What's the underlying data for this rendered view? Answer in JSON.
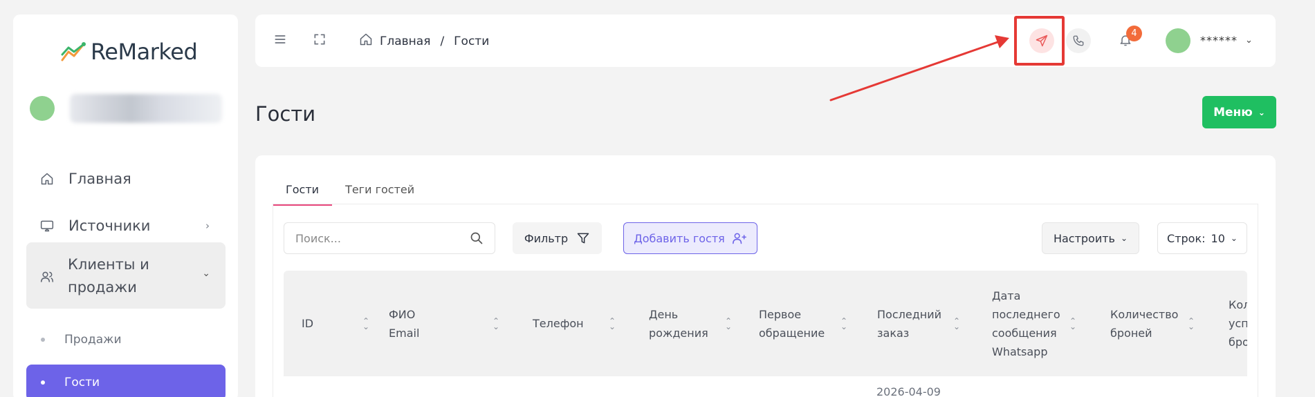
{
  "brand": {
    "name": "ReMarked"
  },
  "sidebar": {
    "items": [
      {
        "label": "Главная",
        "icon": "home-icon"
      },
      {
        "label": "Источники",
        "icon": "monitor-icon"
      },
      {
        "label": "Клиенты и продажи",
        "icon": "users-icon"
      }
    ],
    "subitems": [
      {
        "label": "Продажи",
        "active": false
      },
      {
        "label": "Гости",
        "active": true
      }
    ]
  },
  "header": {
    "breadcrumb": [
      "Главная",
      "Гости"
    ],
    "notifications_count": "4",
    "user_name": "******",
    "icons": [
      "menu-icon",
      "fullscreen-icon",
      "telegram-icon",
      "phone-icon",
      "bell-icon",
      "chevron-down-icon"
    ]
  },
  "page": {
    "title": "Гости",
    "menu_label": "Меню"
  },
  "tabs": [
    "Гости",
    "Теги гостей"
  ],
  "toolbar": {
    "search_placeholder": "Поиск...",
    "filter_label": "Фильтр",
    "add_label": "Добавить гостя",
    "config_label": "Настроить",
    "rows_label": "Строк:",
    "rows_value": "10"
  },
  "table": {
    "columns": [
      {
        "line1": "ID",
        "line2": "",
        "line3": "",
        "line4": ""
      },
      {
        "line1": "ФИО",
        "line2": "Email",
        "line3": "",
        "line4": ""
      },
      {
        "line1": "Телефон",
        "line2": "",
        "line3": "",
        "line4": ""
      },
      {
        "line1": "День",
        "line2": "рождения",
        "line3": "",
        "line4": ""
      },
      {
        "line1": "Первое",
        "line2": "обращение",
        "line3": "",
        "line4": ""
      },
      {
        "line1": "Последний",
        "line2": "заказ",
        "line3": "",
        "line4": ""
      },
      {
        "line1": "Дата",
        "line2": "последнего",
        "line3": "сообщения",
        "line4": "Whatsapp"
      },
      {
        "line1": "Количество",
        "line2": "броней",
        "line3": "",
        "line4": ""
      },
      {
        "line1": "Кол",
        "line2": "усп",
        "line3": "бро",
        "line4": ""
      }
    ],
    "first_row_last_order": "2026-04-09"
  },
  "colors": {
    "accent": "#6d63e8",
    "success": "#1fbf61",
    "badge": "#f26b3a",
    "highlight": "#e53935"
  }
}
